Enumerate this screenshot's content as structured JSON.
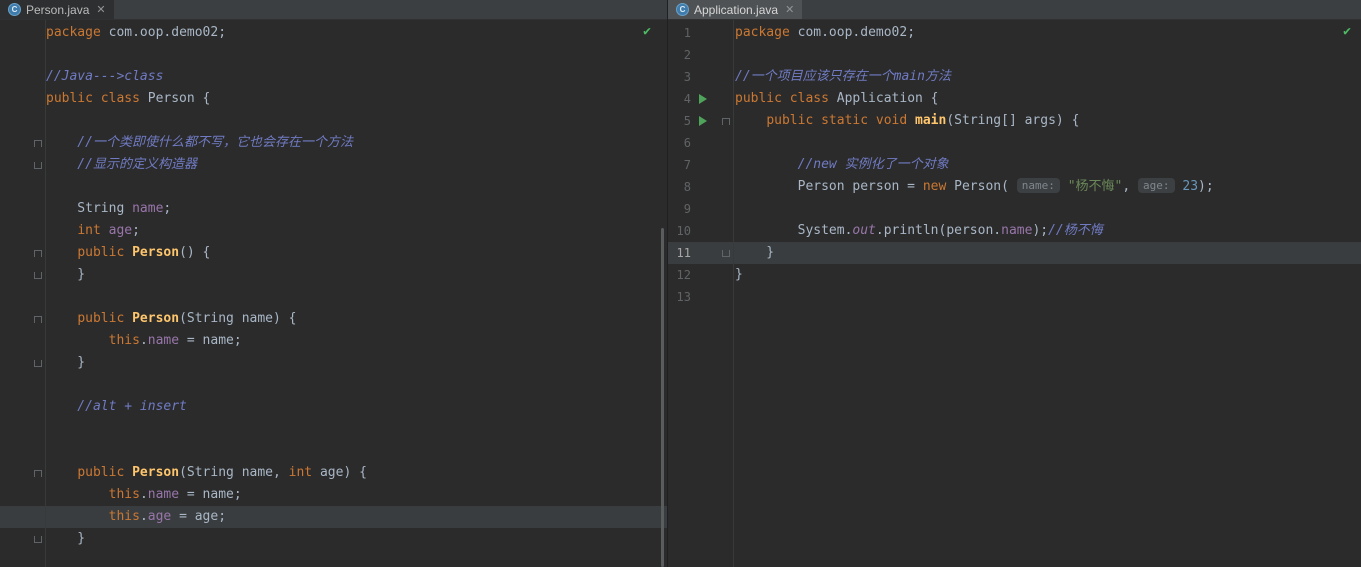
{
  "palette": {
    "editor_bg": "#2B2B2B",
    "tabbar_bg": "#3C3F41",
    "tab_selected_focused_bg": "#4E5254",
    "caret_row_bg": "#3A3D3F",
    "keyword": "#CC7832",
    "plain_text": "#A9B7C6",
    "comment": "#707BC4",
    "field": "#9876AA",
    "method": "#FFC66D",
    "string": "#6A8759",
    "number": "#6897BB",
    "line_number": "#606366",
    "run_arrow_green": "#4FA45B",
    "check_green": "#4DBB63"
  },
  "icons": {
    "class_letter": "C",
    "close": "✕",
    "check": "✔",
    "run": "play-triangle"
  },
  "left_editor": {
    "tab_label": "Person.java",
    "show_line_numbers": false,
    "lines": [
      {
        "tokens": [
          [
            "kw",
            "package"
          ],
          [
            "plain",
            " com.oop.demo02;"
          ]
        ]
      },
      {
        "tokens": []
      },
      {
        "tokens": [
          [
            "comment",
            "//Java--->class"
          ]
        ]
      },
      {
        "tokens": [
          [
            "kw",
            "public class "
          ],
          [
            "plain",
            "Person {"
          ]
        ]
      },
      {
        "tokens": []
      },
      {
        "tokens": [
          [
            "comment",
            "    //一个类即使什么都不写，它也会存在一个方法"
          ]
        ],
        "fold": "top"
      },
      {
        "tokens": [
          [
            "comment",
            "    //显示的定义构造器"
          ]
        ],
        "fold": "bottom"
      },
      {
        "tokens": []
      },
      {
        "tokens": [
          [
            "plain",
            "    String "
          ],
          [
            "field",
            "name"
          ],
          [
            "plain",
            ";"
          ]
        ]
      },
      {
        "tokens": [
          [
            "plain",
            "    "
          ],
          [
            "kw",
            "int "
          ],
          [
            "field",
            "age"
          ],
          [
            "plain",
            ";"
          ]
        ]
      },
      {
        "tokens": [
          [
            "plain",
            "    "
          ],
          [
            "kw",
            "public "
          ],
          [
            "method",
            "Person"
          ],
          [
            "plain",
            "() {"
          ]
        ],
        "fold": "top"
      },
      {
        "tokens": [
          [
            "plain",
            "    }"
          ]
        ],
        "fold": "bottom"
      },
      {
        "tokens": []
      },
      {
        "tokens": [
          [
            "plain",
            "    "
          ],
          [
            "kw",
            "public "
          ],
          [
            "method",
            "Person"
          ],
          [
            "plain",
            "(String name) {"
          ]
        ],
        "fold": "top"
      },
      {
        "tokens": [
          [
            "plain",
            "        "
          ],
          [
            "kw",
            "this"
          ],
          [
            "plain",
            "."
          ],
          [
            "field",
            "name"
          ],
          [
            "plain",
            " = name;"
          ]
        ]
      },
      {
        "tokens": [
          [
            "plain",
            "    }"
          ]
        ],
        "fold": "bottom"
      },
      {
        "tokens": []
      },
      {
        "tokens": [
          [
            "comment",
            "    //alt + insert"
          ]
        ]
      },
      {
        "tokens": []
      },
      {
        "tokens": []
      },
      {
        "tokens": [
          [
            "plain",
            "    "
          ],
          [
            "kw",
            "public "
          ],
          [
            "method",
            "Person"
          ],
          [
            "plain",
            "(String name, "
          ],
          [
            "kw",
            "int"
          ],
          [
            "plain",
            " age) {"
          ]
        ],
        "fold": "top"
      },
      {
        "tokens": [
          [
            "plain",
            "        "
          ],
          [
            "kw",
            "this"
          ],
          [
            "plain",
            "."
          ],
          [
            "field",
            "name"
          ],
          [
            "plain",
            " = name;"
          ]
        ]
      },
      {
        "tokens": [
          [
            "plain",
            "        "
          ],
          [
            "kw",
            "this"
          ],
          [
            "plain",
            "."
          ],
          [
            "field",
            "age"
          ],
          [
            "plain",
            " = age;"
          ]
        ],
        "current": true
      },
      {
        "tokens": [
          [
            "plain",
            "    }"
          ]
        ],
        "fold": "bottom"
      }
    ]
  },
  "right_editor": {
    "tab_label": "Application.java",
    "show_line_numbers": true,
    "lines": [
      {
        "num": "1",
        "tokens": [
          [
            "kw",
            "package"
          ],
          [
            "plain",
            " com.oop.demo02;"
          ]
        ]
      },
      {
        "num": "2",
        "tokens": []
      },
      {
        "num": "3",
        "tokens": [
          [
            "comment",
            "//一个项目应该只存在一个main方法"
          ]
        ]
      },
      {
        "num": "4",
        "tokens": [
          [
            "kw",
            "public class "
          ],
          [
            "plain",
            "Application {"
          ]
        ],
        "run": true
      },
      {
        "num": "5",
        "tokens": [
          [
            "plain",
            "    "
          ],
          [
            "kw",
            "public static void "
          ],
          [
            "method",
            "main"
          ],
          [
            "plain",
            "(String[] args) {"
          ]
        ],
        "run": true,
        "fold": "top"
      },
      {
        "num": "6",
        "tokens": []
      },
      {
        "num": "7",
        "tokens": [
          [
            "comment",
            "        //new 实例化了一个对象"
          ]
        ]
      },
      {
        "num": "8",
        "tokens": [
          [
            "plain",
            "        Person person = "
          ],
          [
            "kw",
            "new"
          ],
          [
            "plain",
            " Person( "
          ],
          [
            "inlay",
            "name:"
          ],
          [
            "plain",
            " "
          ],
          [
            "str",
            "\"杨不悔\""
          ],
          [
            "plain",
            ", "
          ],
          [
            "inlay",
            "age:"
          ],
          [
            "plain",
            " "
          ],
          [
            "num",
            "23"
          ],
          [
            "plain",
            ");"
          ]
        ]
      },
      {
        "num": "9",
        "tokens": []
      },
      {
        "num": "10",
        "tokens": [
          [
            "plain",
            "        System."
          ],
          [
            "sfield",
            "out"
          ],
          [
            "plain",
            ".println(person."
          ],
          [
            "field",
            "name"
          ],
          [
            "plain",
            ");"
          ],
          [
            "comment",
            "//杨不悔"
          ]
        ]
      },
      {
        "num": "11",
        "tokens": [
          [
            "plain",
            "    }"
          ]
        ],
        "current": true,
        "fold": "bottom"
      },
      {
        "num": "12",
        "tokens": [
          [
            "plain",
            "}"
          ]
        ]
      },
      {
        "num": "13",
        "tokens": []
      }
    ]
  }
}
